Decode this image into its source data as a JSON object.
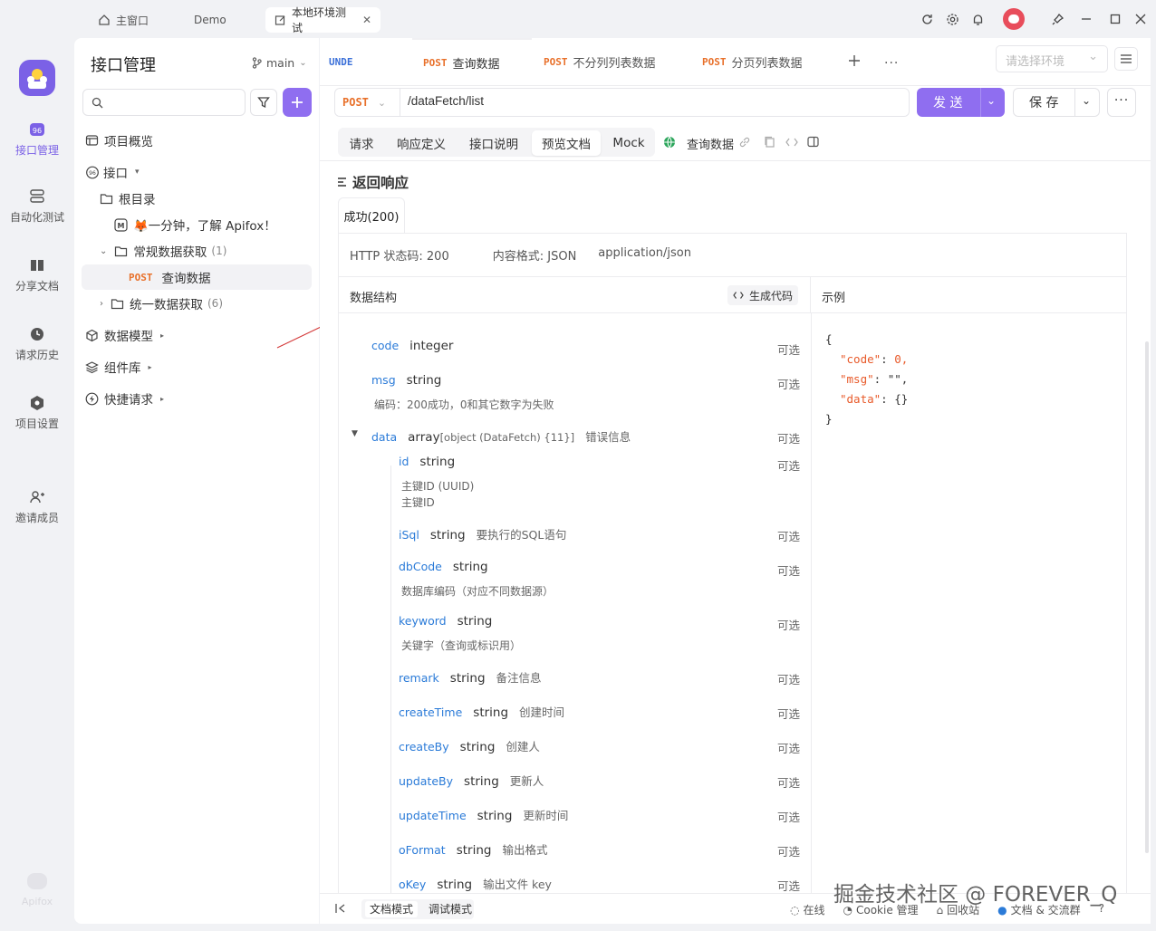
{
  "titlebar": {
    "home": "主窗口",
    "demo": "Demo",
    "active_tab": "本地环境测试"
  },
  "rail": {
    "items": [
      "接口管理",
      "自动化测试",
      "分享文档",
      "请求历史",
      "项目设置",
      "邀请成员"
    ],
    "brand": "Apifox"
  },
  "sidebar": {
    "title": "接口管理",
    "branch": "main",
    "tree": {
      "overview": "项目概览",
      "api": "接口",
      "root": "根目录",
      "intro": "🦊一分钟，了解 Apifox！",
      "folder1": "常规数据获取",
      "folder1_count": "(1)",
      "post": "POST",
      "item": "查询数据",
      "folder2": "统一数据获取",
      "folder2_count": "(6)",
      "models": "数据模型",
      "components": "组件库",
      "quick": "快捷请求"
    }
  },
  "tabs": {
    "unde": "UNDE",
    "t1": "查询数据",
    "t2": "不分列列表数据",
    "t3": "分页列表数据",
    "post": "POST",
    "env_placeholder": "请选择环境"
  },
  "request": {
    "method": "POST",
    "url": "/dataFetch/list",
    "send": "发 送",
    "save": "保 存"
  },
  "subtabs": {
    "request": "请求",
    "response_def": "响应定义",
    "api_doc": "接口说明",
    "preview_doc": "预览文档",
    "mock": "Mock",
    "name": "查询数据"
  },
  "response": {
    "title": "返回响应",
    "success": "成功(200)",
    "http_status": "HTTP 状态码: 200",
    "content_format": "内容格式: JSON",
    "mime": "application/json",
    "structure": "数据结构",
    "gen_code": "生成代码",
    "example": "示例"
  },
  "fields": [
    {
      "name": "code",
      "type": "integer",
      "desc": "",
      "opt": "可选",
      "sub": []
    },
    {
      "name": "msg",
      "type": "string",
      "desc": "",
      "opt": "可选",
      "sub": [
        "编码：200成功，0和其它数字为失败"
      ]
    },
    {
      "name": "data",
      "type": "array",
      "type_extra": "[object (DataFetch) {11}]",
      "desc": "错误信息",
      "opt": "可选",
      "sub": []
    },
    {
      "name": "id",
      "type": "string",
      "desc": "",
      "opt": "可选",
      "sub": [
        "主键ID (UUID)",
        "主键ID"
      ]
    },
    {
      "name": "iSql",
      "type": "string",
      "desc": "要执行的SQL语句",
      "opt": "可选",
      "sub": []
    },
    {
      "name": "dbCode",
      "type": "string",
      "desc": "",
      "opt": "可选",
      "sub": [
        "数据库编码（对应不同数据源）"
      ]
    },
    {
      "name": "keyword",
      "type": "string",
      "desc": "",
      "opt": "可选",
      "sub": [
        "关键字（查询或标识用）"
      ]
    },
    {
      "name": "remark",
      "type": "string",
      "desc": "备注信息",
      "opt": "可选",
      "sub": []
    },
    {
      "name": "createTime",
      "type": "string",
      "desc": "创建时间",
      "opt": "可选",
      "sub": []
    },
    {
      "name": "createBy",
      "type": "string",
      "desc": "创建人",
      "opt": "可选",
      "sub": []
    },
    {
      "name": "updateBy",
      "type": "string",
      "desc": "更新人",
      "opt": "可选",
      "sub": []
    },
    {
      "name": "updateTime",
      "type": "string",
      "desc": "更新时间",
      "opt": "可选",
      "sub": []
    },
    {
      "name": "oFormat",
      "type": "string",
      "desc": "输出格式",
      "opt": "可选",
      "sub": []
    },
    {
      "name": "oKey",
      "type": "string",
      "desc": "输出文件 key",
      "opt": "可选",
      "sub": []
    }
  ],
  "example_json": {
    "open": "{",
    "l1_key": "\"code\"",
    "l1_val": "0,",
    "l2_key": "\"msg\"",
    "l2_val": "\"\",",
    "l3_key": "\"data\"",
    "l3_val": "{}",
    "close": "}"
  },
  "footer": {
    "doc_mode": "文档模式",
    "debug_mode": "调试模式",
    "online": "在线",
    "cookie": "Cookie 管理",
    "recycle": "回收站",
    "community": "文档 & 交流群"
  },
  "watermark": "掘金技术社区 @ FOREVER_Q"
}
